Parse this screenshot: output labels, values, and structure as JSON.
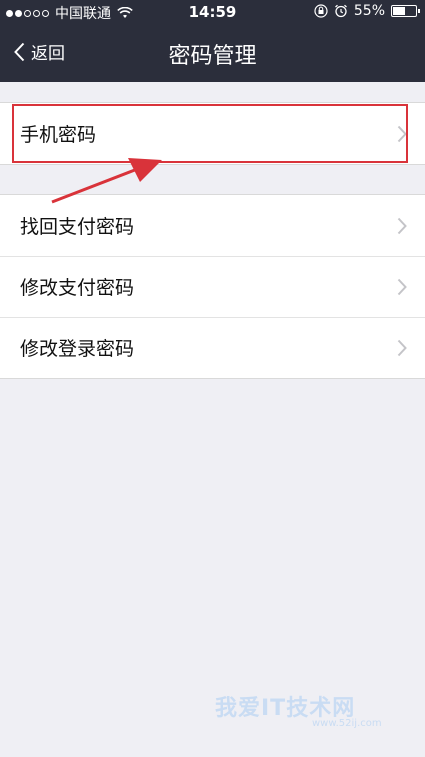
{
  "statusbar": {
    "carrier": "中国联通",
    "time": "14:59",
    "battery": "55%",
    "battery_level": 0.55,
    "signal_bars_filled": 2,
    "signal_bars_total": 5
  },
  "navbar": {
    "back_label": "返回",
    "title": "密码管理"
  },
  "groups": [
    {
      "items": [
        {
          "label": "手机密码"
        }
      ]
    },
    {
      "items": [
        {
          "label": "找回支付密码"
        },
        {
          "label": "修改支付密码"
        },
        {
          "label": "修改登录密码"
        }
      ]
    }
  ],
  "watermark": {
    "text": "我爱IT技术网",
    "sub": "www.52ij.com"
  },
  "colors": {
    "navbar": "#2b2e3b",
    "background": "#efeff4",
    "highlight": "#d9333a"
  }
}
